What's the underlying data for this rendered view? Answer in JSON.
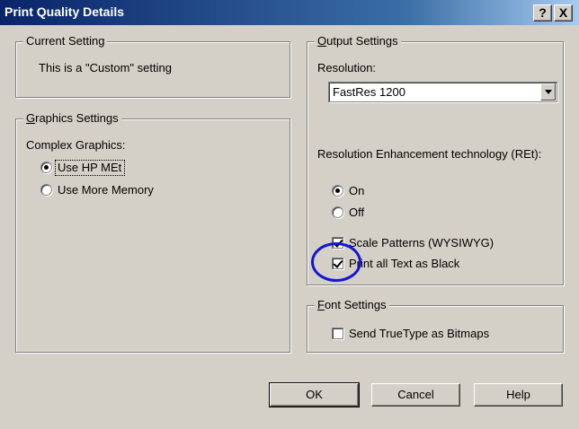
{
  "window": {
    "title": "Print Quality Details",
    "help_label": "?",
    "close_label": "X"
  },
  "current_setting": {
    "label": "Current Setting",
    "text": "This is a \"Custom\" setting"
  },
  "graphics_settings": {
    "label_underlined": "G",
    "label_rest": "raphics Settings",
    "complex_graphics_label": "Complex Graphics:",
    "options": [
      {
        "label": "Use HP MEt",
        "selected": true
      },
      {
        "label": "Use More Memory",
        "selected": false
      }
    ]
  },
  "output_settings": {
    "label_underlined": "O",
    "label_rest": "utput Settings",
    "resolution_label": "Resolution:",
    "resolution_value": "FastRes 1200",
    "ret_label": "Resolution Enhancement technology (REt):",
    "ret_options": [
      {
        "label": "On",
        "selected": true
      },
      {
        "label": "Off",
        "selected": false
      }
    ],
    "checkboxes": [
      {
        "label": "Scale Patterns (WYSIWYG)",
        "checked": true
      },
      {
        "label": "Print all Text as Black",
        "checked": true
      }
    ]
  },
  "font_settings": {
    "label_underlined": "F",
    "label_rest": "ont Settings",
    "checkbox_label": "Send TrueType as Bitmaps",
    "checked": false
  },
  "buttons": {
    "ok": "OK",
    "cancel": "Cancel",
    "help": "Help"
  },
  "annotation_color": "#1515d6"
}
